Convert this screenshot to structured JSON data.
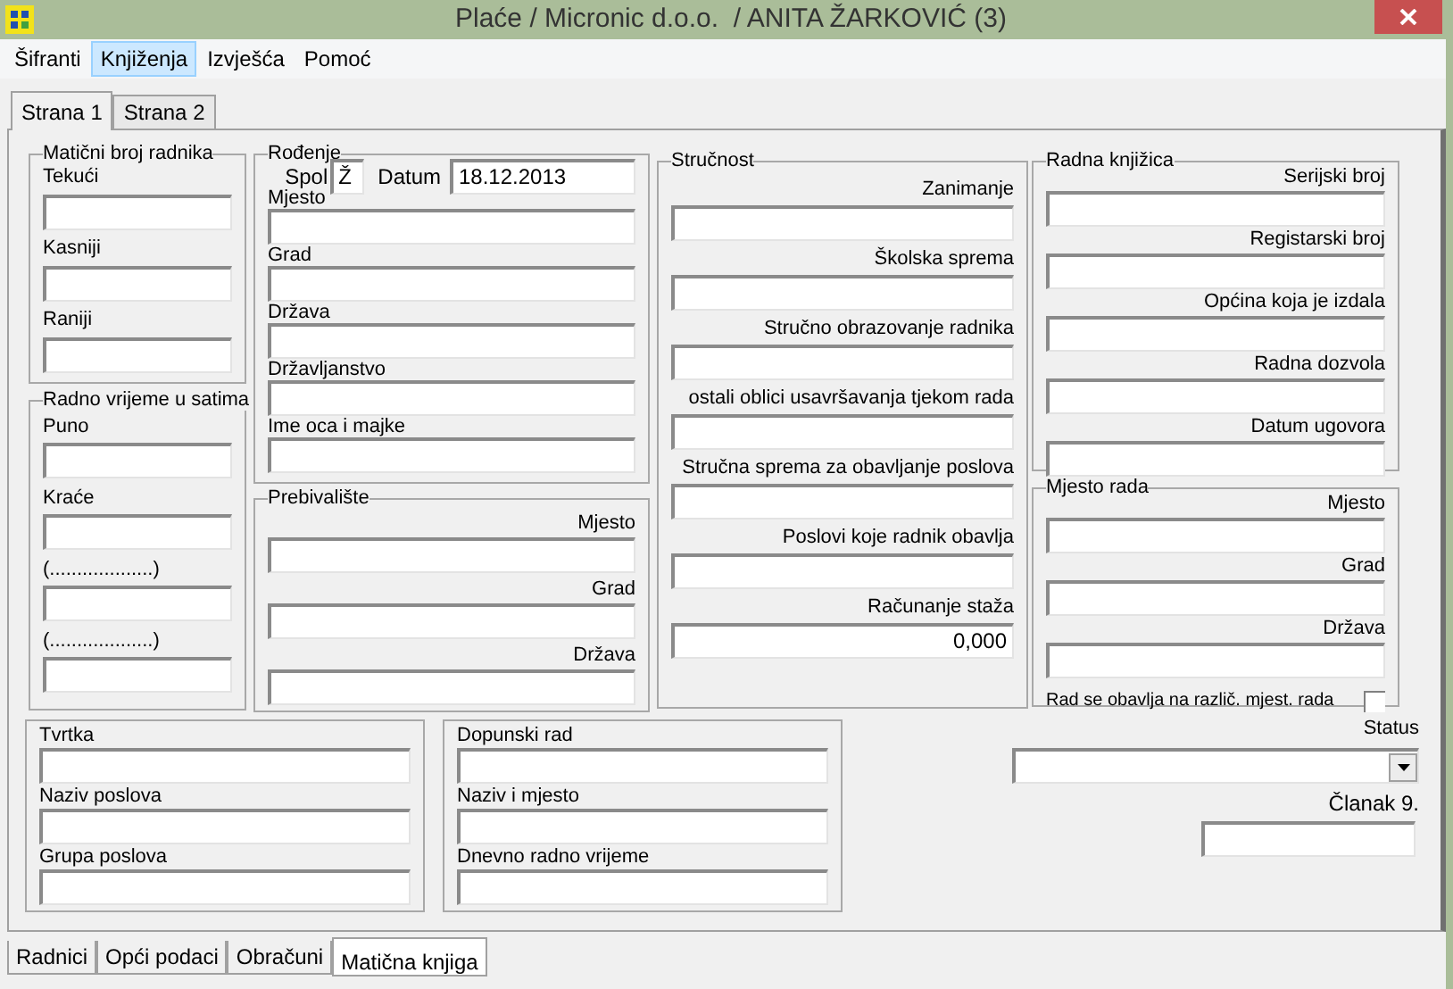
{
  "window": {
    "title": "Plaće / Micronic d.o.o.  / ANITA ŽARKOVIĆ (3)"
  },
  "menu": [
    {
      "label": "Šifranti",
      "selected": false
    },
    {
      "label": "Knjiženja",
      "selected": true
    },
    {
      "label": "Izvješća",
      "selected": false
    },
    {
      "label": "Pomoć",
      "selected": false
    }
  ],
  "tabs": [
    {
      "label": "Strana 1",
      "selected": true
    },
    {
      "label": "Strana 2",
      "selected": false
    }
  ],
  "employee_number": {
    "title": "Matični broj radnika",
    "fields": [
      {
        "label": "Tekući"
      },
      {
        "label": "Kasniji"
      },
      {
        "label": "Raniji"
      }
    ]
  },
  "working_hours": {
    "title": "Radno vrijeme u satima",
    "fields": [
      {
        "label": "Puno"
      },
      {
        "label": "Kraće"
      },
      {
        "label": "(...................)"
      },
      {
        "label": "(...................)"
      }
    ]
  },
  "birth": {
    "title": "Rođenje",
    "gender": {
      "label": "Spol",
      "value": "Ž"
    },
    "date": {
      "label": "Datum",
      "value": "18.12.2013"
    },
    "fields": [
      {
        "label": "Mjesto"
      },
      {
        "label": "Grad"
      },
      {
        "label": "Država"
      },
      {
        "label": "Državljanstvo"
      },
      {
        "label": "Ime oca i majke"
      }
    ]
  },
  "residence": {
    "title": "Prebivalište",
    "fields": [
      {
        "label": "Mjesto"
      },
      {
        "label": "Grad"
      },
      {
        "label": "Država"
      }
    ]
  },
  "qualification": {
    "title": "Stručnost",
    "fields": [
      {
        "label": "Zanimanje"
      },
      {
        "label": "Školska sprema"
      },
      {
        "label": "Stručno obrazovanje radnika"
      },
      {
        "label": "ostali oblici usavršavanja tjekom rada"
      },
      {
        "label": "Stručna sprema za obavljanje poslova"
      },
      {
        "label": "Poslovi koje radnik obavlja"
      },
      {
        "label": "Računanje staža",
        "value": "0,000"
      }
    ]
  },
  "work_booklet": {
    "title": "Radna knjižica",
    "fields": [
      {
        "label": "Serijski broj"
      },
      {
        "label": "Registarski broj"
      },
      {
        "label": "Općina koja je izdala"
      },
      {
        "label": "Radna dozvola"
      },
      {
        "label": "Datum ugovora"
      }
    ]
  },
  "workplace": {
    "title": "Mjesto rada",
    "fields": [
      {
        "label": "Mjesto"
      },
      {
        "label": "Grad"
      },
      {
        "label": "Država"
      }
    ],
    "checkbox": {
      "label": "Rad se obavlja na različ. mjest. rada",
      "checked": false
    }
  },
  "company": {
    "fields": [
      {
        "label": "Tvrtka"
      },
      {
        "label": "Naziv poslova"
      },
      {
        "label": "Grupa poslova"
      }
    ]
  },
  "supplementary_work": {
    "fields": [
      {
        "label": "Dopunski rad"
      },
      {
        "label": "Naziv i mjesto"
      },
      {
        "label": "Dnevno radno vrijeme"
      }
    ]
  },
  "status": {
    "label": "Status"
  },
  "article_9": {
    "label": "Članak 9."
  },
  "bottom_tabs": [
    {
      "label": "Radnici",
      "selected": false
    },
    {
      "label": "Opći podaci",
      "selected": false
    },
    {
      "label": "Obračuni",
      "selected": false
    },
    {
      "label": "Matična knjiga",
      "selected": true
    }
  ]
}
